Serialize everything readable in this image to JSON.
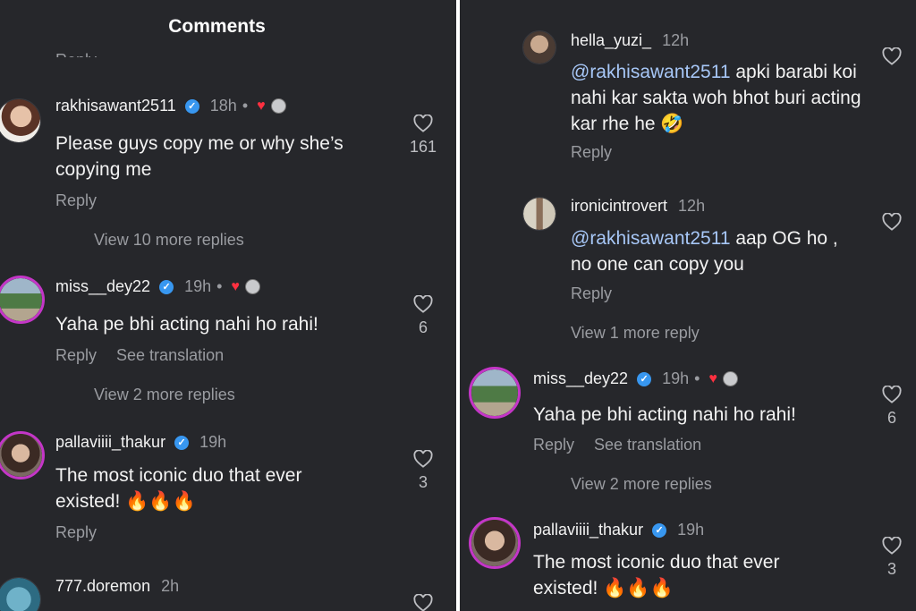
{
  "left": {
    "title": "Comments",
    "cut_reply": "Reply",
    "c1": {
      "user": "rakhisawant2511",
      "time": "18h",
      "dot": "•",
      "text": "Please guys copy me or why she’s copying me",
      "reply": "Reply",
      "more": "View 10 more replies",
      "likes": "161"
    },
    "c2": {
      "user": "miss__dey22",
      "time": "19h",
      "dot": "•",
      "text": "Yaha pe bhi acting nahi ho rahi!",
      "reply": "Reply",
      "translate": "See translation",
      "more": "View 2 more replies",
      "likes": "6"
    },
    "c3": {
      "user": "pallaviiii_thakur",
      "time": "19h",
      "text": "The most iconic duo that ever existed! 🔥🔥🔥",
      "reply": "Reply",
      "likes": "3"
    },
    "c4": {
      "user": "777.doremon",
      "time": "2h"
    }
  },
  "right": {
    "r1": {
      "user": "hella_yuzi_",
      "time": "12h",
      "mention": "@rakhisawant2511",
      "text": " apki barabi koi nahi kar sakta woh bhot buri acting kar rhe he 🤣",
      "reply": "Reply"
    },
    "r2": {
      "user": "ironicintrovert",
      "time": "12h",
      "mention": "@rakhisawant2511",
      "text": "  aap OG ho , no one can copy you",
      "reply": "Reply",
      "more": "View 1 more reply"
    },
    "c2": {
      "user": "miss__dey22",
      "time": "19h",
      "dot": "•",
      "text": "Yaha pe bhi acting nahi ho rahi!",
      "reply": "Reply",
      "translate": "See translation",
      "more": "View 2 more replies",
      "likes": "6"
    },
    "c3": {
      "user": "pallaviiii_thakur",
      "time": "19h",
      "text": "The most iconic duo that ever existed! 🔥🔥🔥",
      "likes": "3"
    }
  },
  "icons": {
    "like": "heart-outline-icon",
    "verified": "verified-check-icon",
    "liked_by_author": "heart-filled-icon"
  },
  "colors": {
    "background": "#26272b",
    "text": "#f2f2f2",
    "muted": "#9a9ca1",
    "mention": "#a7c7f7",
    "verified": "#3897f0",
    "heart": "#ff3040",
    "story_ring": "#c436c7"
  }
}
